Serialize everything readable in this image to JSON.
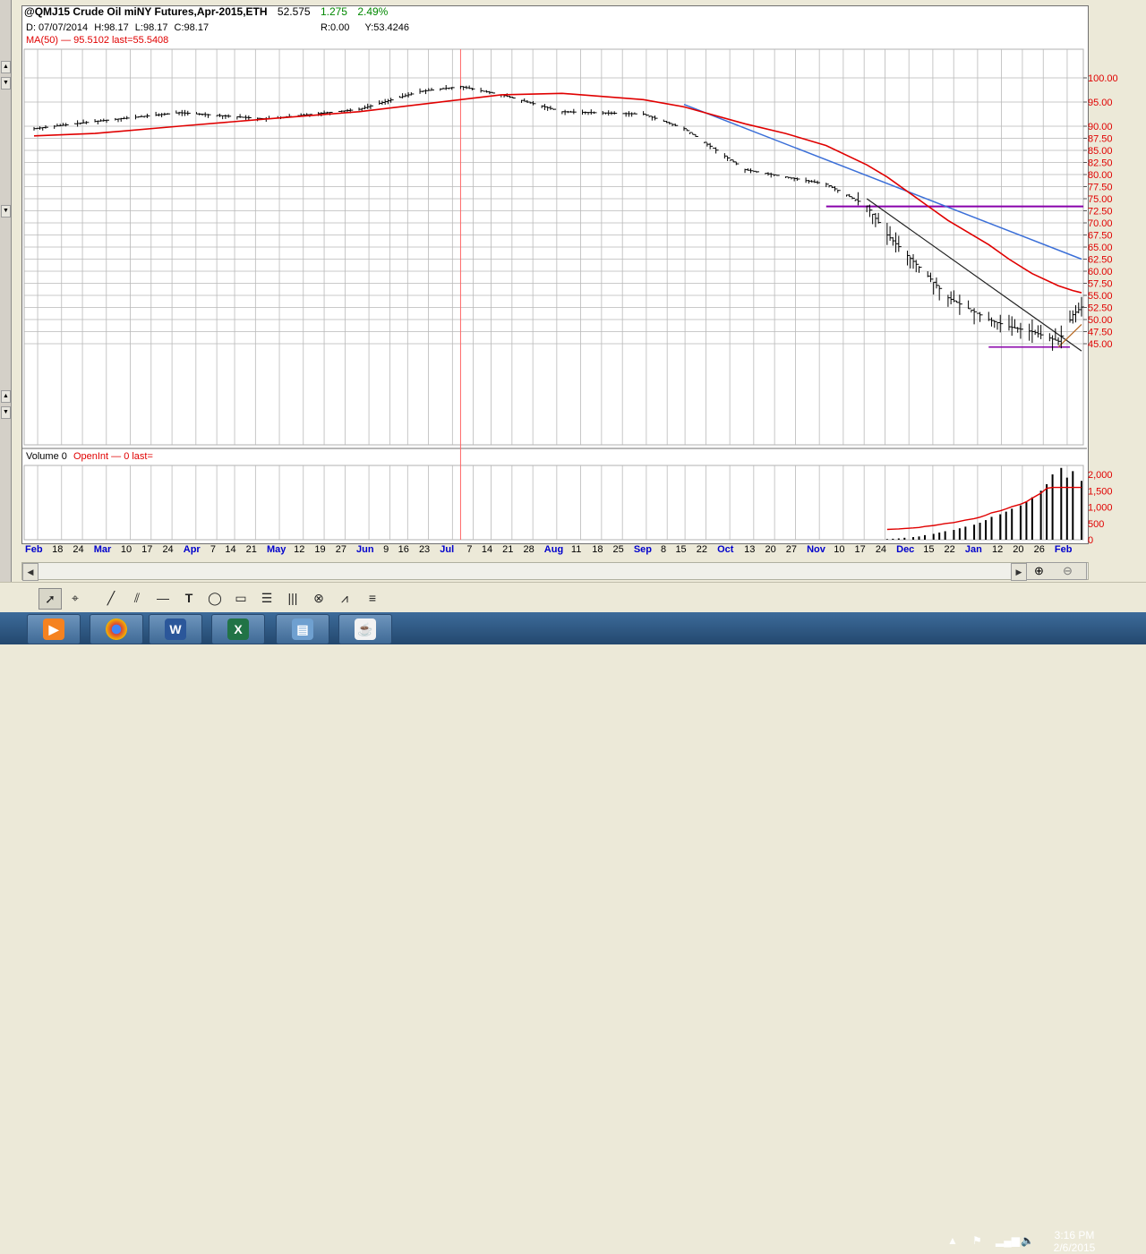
{
  "header": {
    "symbol": "@QMJ15 Crude Oil miNY Futures,Apr-2015,ETH",
    "last": "52.575",
    "change": "1.275",
    "pct": "2.49%"
  },
  "ohlc": {
    "d": "D: 07/07/2014",
    "h": "H:98.17",
    "l": "L:98.17",
    "c": "C:98.17"
  },
  "ry": {
    "r": "R:0.00",
    "y": "Y:53.4246"
  },
  "ma_legend": "MA(50) — 95.5102 last=55.5408",
  "vol_legend": {
    "vol": "Volume 0",
    "openint": "OpenInt — 0 last="
  },
  "colors": {
    "price_bars": "#000000",
    "ma": "#e00000",
    "trend_blue": "#3b6fd8",
    "trend_black": "#222222",
    "support_purple": "#8800aa",
    "grid": "#b9b9b9",
    "axis_text": "#e00000",
    "date_text": "#0000cc"
  },
  "chart_data": [
    {
      "type": "line",
      "panel": "price",
      "title": "@QMJ15 Crude Oil miNY Futures,Apr-2015,ETH",
      "x": [
        "2014-02-10",
        "2014-03-03",
        "2014-04-01",
        "2014-05-01",
        "2014-06-02",
        "2014-06-23",
        "2014-07-07",
        "2014-07-21",
        "2014-08-11",
        "2014-09-08",
        "2014-09-22",
        "2014-10-13",
        "2014-10-27",
        "2014-11-10",
        "2014-11-24",
        "2014-12-01",
        "2014-12-15",
        "2014-12-22",
        "2015-01-05",
        "2015-01-12",
        "2015-01-20",
        "2015-01-29",
        "2015-02-03",
        "2015-02-06"
      ],
      "series": [
        {
          "name": "Price",
          "values": [
            89.5,
            91.0,
            92.8,
            91.5,
            93.5,
            97.2,
            98.2,
            96.5,
            93.0,
            92.5,
            89.5,
            81.0,
            79.5,
            78.0,
            73.5,
            67.5,
            59.0,
            54.5,
            50.0,
            48.5,
            47.5,
            45.5,
            51.0,
            52.575
          ]
        },
        {
          "name": "MA(50)",
          "values": [
            88.0,
            88.5,
            90.0,
            91.5,
            93.0,
            94.5,
            95.5,
            96.5,
            96.8,
            95.5,
            94.0,
            90.5,
            88.5,
            86.0,
            82.0,
            79.5,
            73.5,
            70.5,
            65.5,
            62.5,
            59.5,
            57.0,
            56.0,
            55.5408
          ]
        }
      ],
      "ylim": [
        43.5,
        101
      ],
      "yticks": [
        100.0,
        95.0,
        90.0,
        87.5,
        85.0,
        82.5,
        80.0,
        77.5,
        75.0,
        72.5,
        70.0,
        67.5,
        65.0,
        62.5,
        60.0,
        57.5,
        55.0,
        52.5,
        50.0,
        47.5,
        45.0
      ],
      "date_ticks": [
        {
          "label": "Feb",
          "c": "blue"
        },
        {
          "label": "18",
          "c": "black"
        },
        {
          "label": "24",
          "c": "black"
        },
        {
          "label": "Mar",
          "c": "blue"
        },
        {
          "label": "10",
          "c": "black"
        },
        {
          "label": "17",
          "c": "black"
        },
        {
          "label": "24",
          "c": "black"
        },
        {
          "label": "Apr",
          "c": "blue"
        },
        {
          "label": "7",
          "c": "black"
        },
        {
          "label": "14",
          "c": "black"
        },
        {
          "label": "21",
          "c": "black"
        },
        {
          "label": "May",
          "c": "blue"
        },
        {
          "label": "12",
          "c": "black"
        },
        {
          "label": "19",
          "c": "black"
        },
        {
          "label": "27",
          "c": "black"
        },
        {
          "label": "Jun",
          "c": "blue"
        },
        {
          "label": "9",
          "c": "black"
        },
        {
          "label": "16",
          "c": "black"
        },
        {
          "label": "23",
          "c": "black"
        },
        {
          "label": "Jul",
          "c": "blue"
        },
        {
          "label": "7",
          "c": "black"
        },
        {
          "label": "14",
          "c": "black"
        },
        {
          "label": "21",
          "c": "black"
        },
        {
          "label": "28",
          "c": "black"
        },
        {
          "label": "Aug",
          "c": "blue"
        },
        {
          "label": "11",
          "c": "black"
        },
        {
          "label": "18",
          "c": "black"
        },
        {
          "label": "25",
          "c": "black"
        },
        {
          "label": "Sep",
          "c": "blue"
        },
        {
          "label": "8",
          "c": "black"
        },
        {
          "label": "15",
          "c": "black"
        },
        {
          "label": "22",
          "c": "black"
        },
        {
          "label": "Oct",
          "c": "blue"
        },
        {
          "label": "13",
          "c": "black"
        },
        {
          "label": "20",
          "c": "black"
        },
        {
          "label": "27",
          "c": "black"
        },
        {
          "label": "Nov",
          "c": "blue"
        },
        {
          "label": "10",
          "c": "black"
        },
        {
          "label": "17",
          "c": "black"
        },
        {
          "label": "24",
          "c": "black"
        },
        {
          "label": "Dec",
          "c": "blue"
        },
        {
          "label": "15",
          "c": "black"
        },
        {
          "label": "22",
          "c": "black"
        },
        {
          "label": "Jan",
          "c": "blue"
        },
        {
          "label": "12",
          "c": "black"
        },
        {
          "label": "20",
          "c": "black"
        },
        {
          "label": "26",
          "c": "black"
        },
        {
          "label": "Feb",
          "c": "blue"
        }
      ],
      "annotations": {
        "hline_purple_upper": 73.4,
        "hline_purple_lower": 44.3,
        "blue_trend": {
          "from": [
            "2014-09-22",
            94.5
          ],
          "to": [
            "2015-02-06",
            62.5
          ]
        },
        "black_trend": {
          "from": [
            "2014-11-24",
            75.0
          ],
          "to": [
            "2015-02-06",
            43.5
          ]
        },
        "brown_trend": {
          "from": [
            "2015-01-29",
            44.3
          ],
          "to": [
            "2015-02-06",
            49.0
          ]
        },
        "vertical_marker": "2014-07-07"
      },
      "grid": true
    },
    {
      "type": "bar",
      "panel": "volume",
      "legend": "Volume 0",
      "ylim": [
        0,
        2300
      ],
      "yticks": [
        2000,
        1500,
        1000,
        500,
        0
      ],
      "ytick_labels": [
        "2,000",
        "1,500",
        "1,000",
        "500",
        "0"
      ],
      "volume_recent": [
        20,
        30,
        40,
        60,
        80,
        100,
        140,
        180,
        220,
        260,
        300,
        350,
        400,
        460,
        520,
        600,
        700,
        780,
        860,
        950,
        1050,
        1150,
        1300,
        1500,
        1700,
        2000,
        2200,
        1900,
        2100,
        1800
      ]
    }
  ],
  "toolbar": {
    "icons": [
      "pointer-icon",
      "crosshair-icon",
      "line-icon",
      "parallel-lines-icon",
      "horizontal-line-icon",
      "text-icon",
      "ellipse-icon",
      "rectangle-icon",
      "fib-icon",
      "bars-icon",
      "andrews-icon",
      "gann-icon",
      "menu-icon"
    ]
  },
  "taskbar": {
    "apps": [
      "media-player-icon",
      "chrome-icon",
      "word-icon",
      "excel-icon",
      "notebook-icon",
      "java-icon"
    ],
    "time": "3:16 PM",
    "date": "2/6/2015"
  }
}
